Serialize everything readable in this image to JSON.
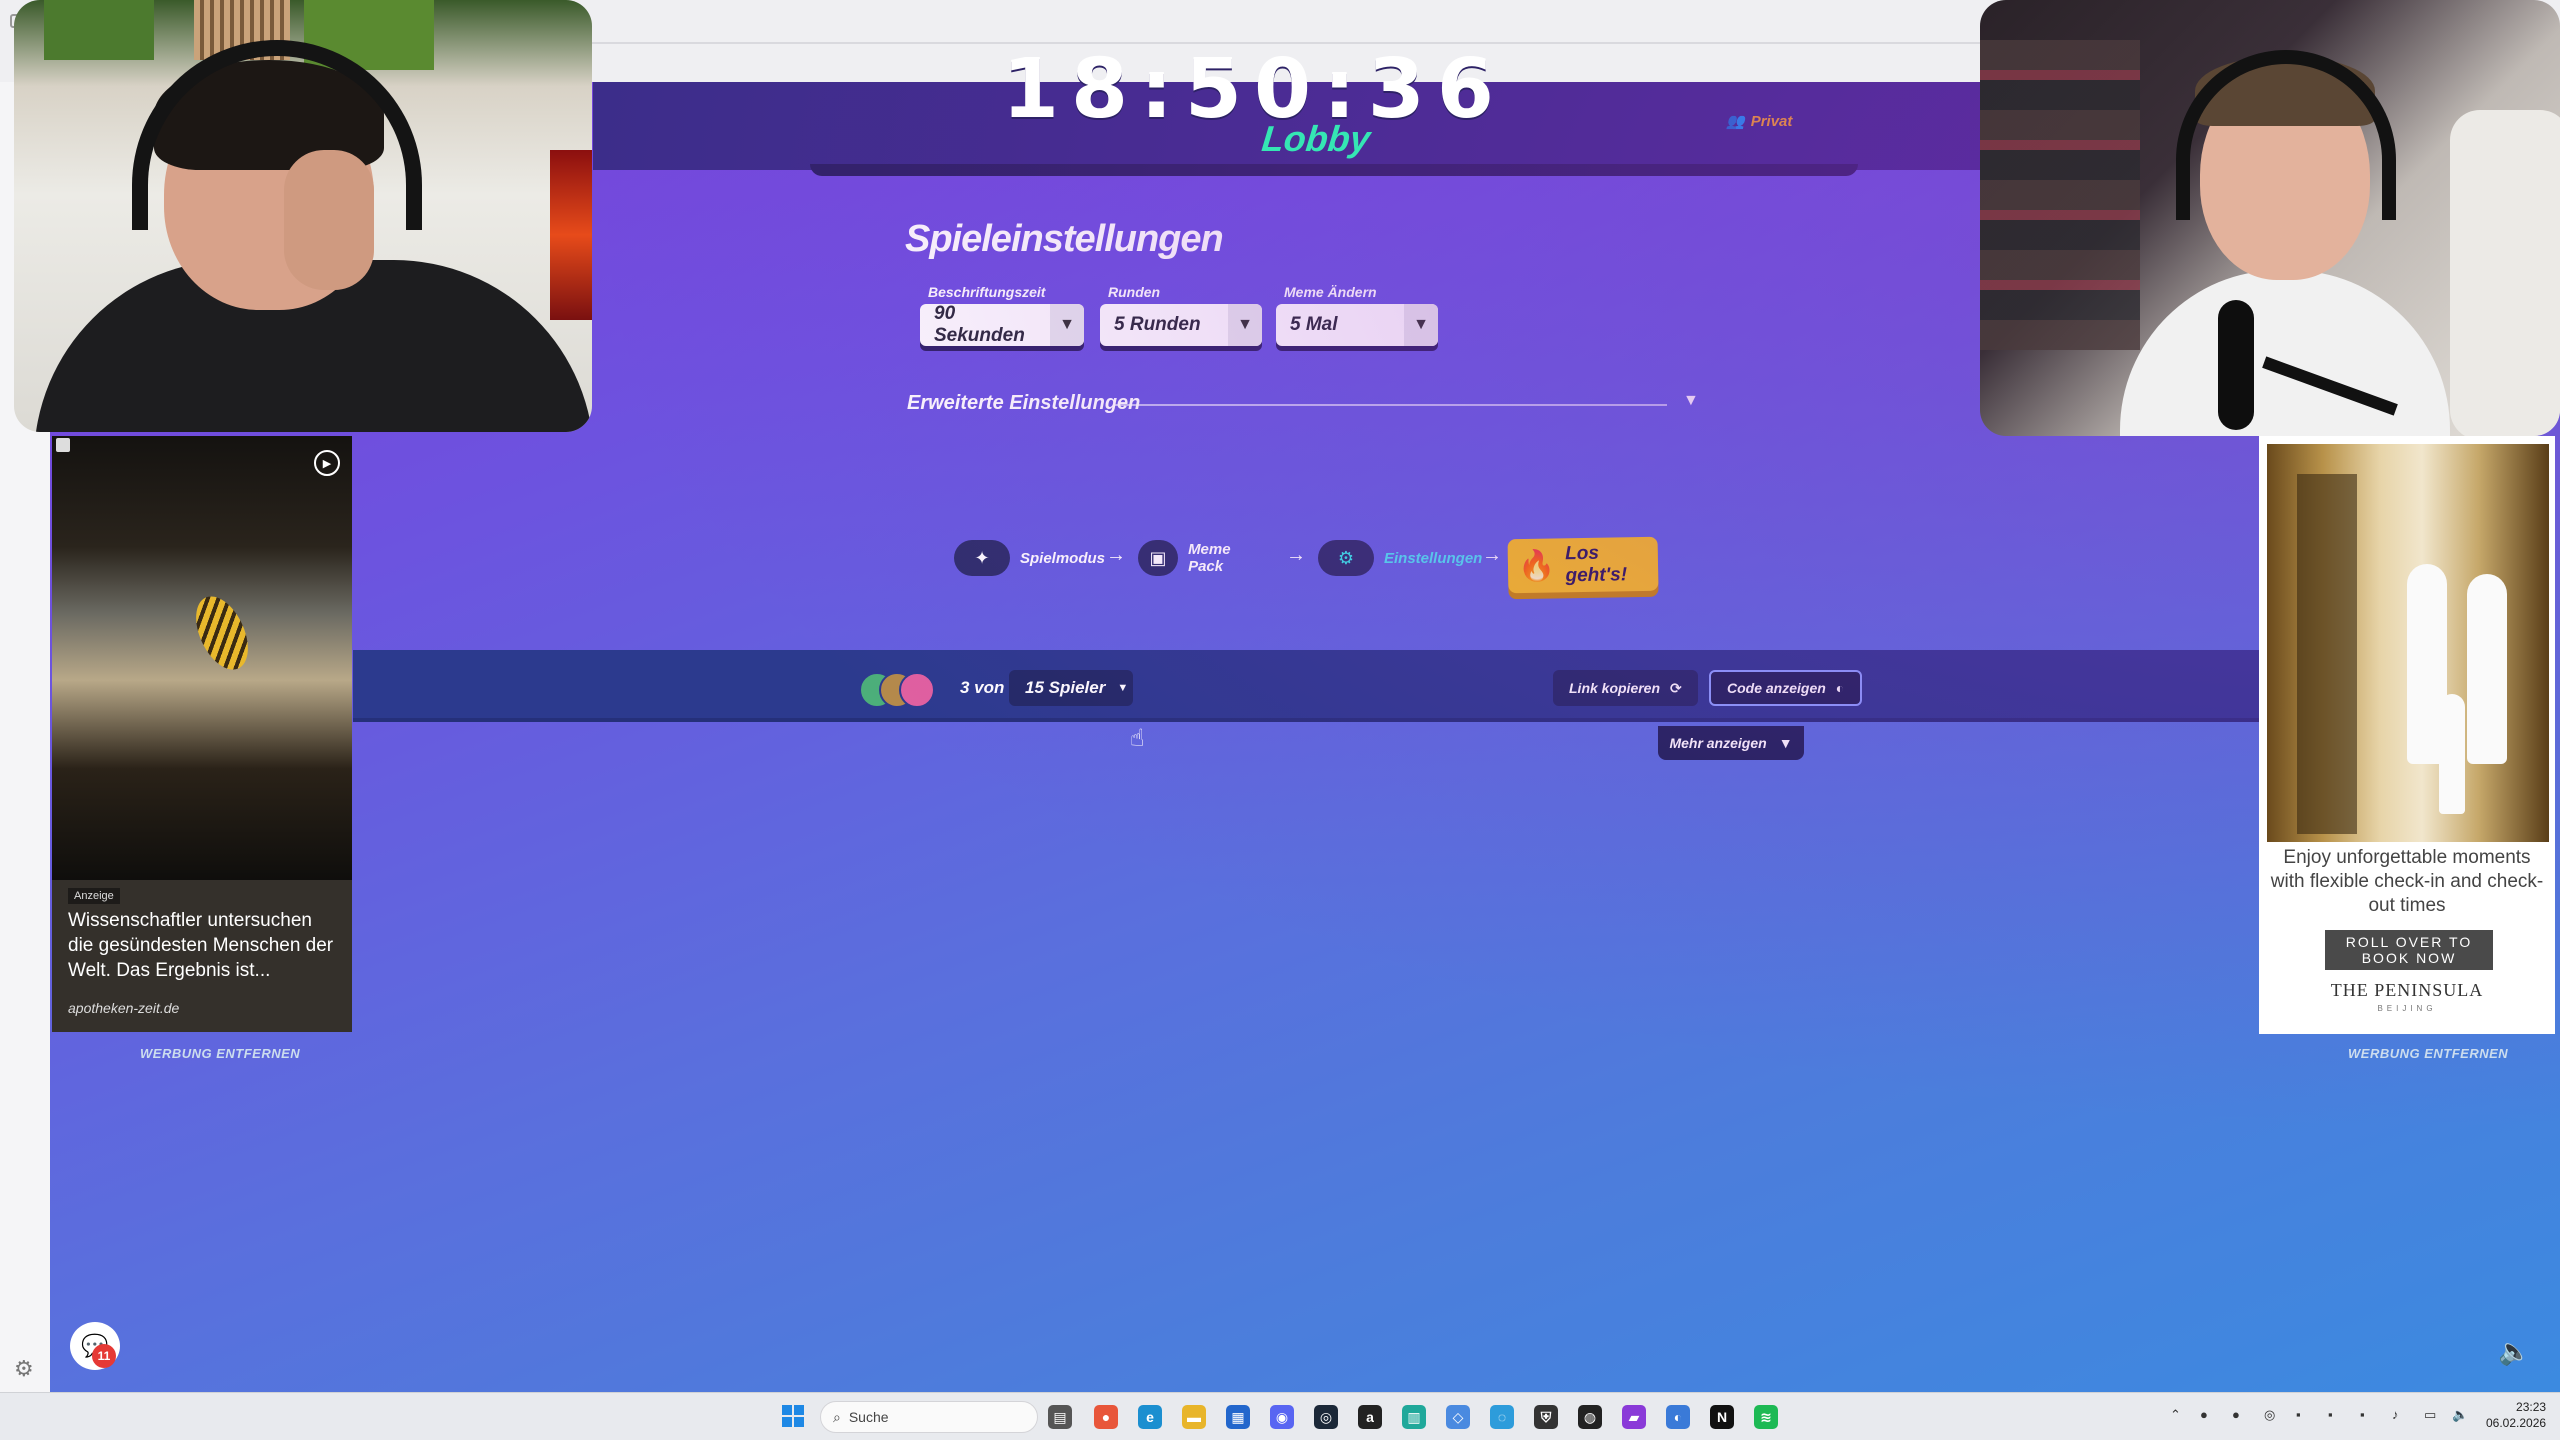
{
  "game": {
    "clock": "18:50:36",
    "lobby_title": "Lobby",
    "privacy_label": "Privat",
    "settings_title": "Spieleinstellungen",
    "fields": [
      {
        "label": "Beschriftungszeit",
        "value": "90 Sekunden"
      },
      {
        "label": "Runden",
        "value": "5 Runden"
      },
      {
        "label": "Meme Ändern",
        "value": "5 Mal"
      }
    ],
    "advanced_label": "Erweiterte Einstellungen",
    "steps": [
      {
        "label": "Spielmodus",
        "icon": "star-wand-icon"
      },
      {
        "label": "Meme Pack",
        "icon": "card-pack-icon"
      },
      {
        "label": "Einstellungen",
        "icon": "gear-icon"
      }
    ],
    "go_label": "Los geht's!",
    "players": {
      "count_text": "3 von",
      "max_players": "15 Spieler",
      "copy_link": "Link kopieren",
      "show_code": "Code anzeigen",
      "show_more": "Mehr anzeigen"
    }
  },
  "ads": {
    "left": {
      "tag": "Anzeige",
      "headline": "Wissenschaftler untersuchen die gesündesten Menschen der Welt. Das Ergebnis ist...",
      "source": "apotheken-zeit.de",
      "remove_label": "WERBUNG ENTFERNEN"
    },
    "right": {
      "copy": "Enjoy unforgettable moments with flexible check-in and check-out times",
      "cta": "ROLL OVER TO BOOK NOW",
      "brand": "THE PENINSULA",
      "brand_sub": "BEIJING",
      "remove_label": "WERBUNG ENTFERNEN"
    }
  },
  "chat": {
    "badge": "11"
  },
  "taskbar": {
    "search_placeholder": "Suche",
    "time": "23:23",
    "date": "06.02.2026"
  },
  "colors": {
    "accent_green": "#35e6b4",
    "go_yellow": "#f8c21d",
    "bar_navy": "#2c3a8e",
    "privacy_orange": "#f7a823"
  }
}
